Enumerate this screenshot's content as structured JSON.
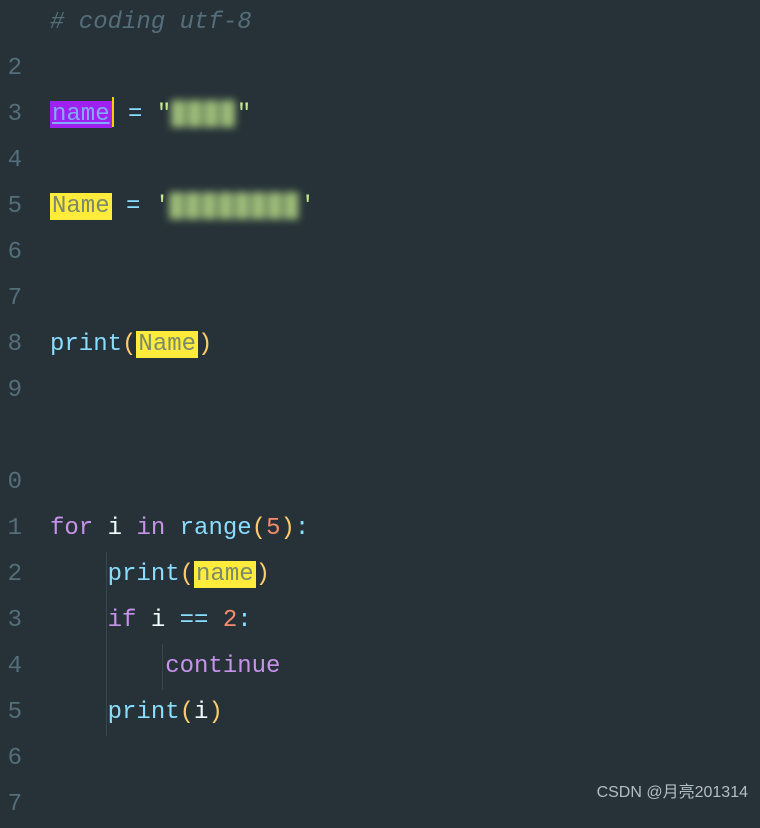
{
  "gutter": {
    "lines": [
      "",
      "2",
      "3",
      "4",
      "5",
      "6",
      "7",
      "8",
      "9",
      "",
      "0",
      "1",
      "2",
      "3",
      "4",
      "5",
      "6",
      "7"
    ]
  },
  "code": {
    "line1": {
      "comment": "# coding utf-8"
    },
    "line3": {
      "var_name": "name",
      "assign": " = ",
      "quote_open": "\"",
      "value_obscured": "▓▓▓▓",
      "quote_close": "\""
    },
    "line5": {
      "var_name": "Name",
      "assign": " = ",
      "quote_open": "'",
      "value_obscured": "▓▓▓▓▓▓▓▓",
      "quote_close": "'"
    },
    "line8": {
      "func": "print",
      "paren_open": "(",
      "arg": "Name",
      "paren_close": ")"
    },
    "line12": {
      "for_kw": "for",
      "var": " i ",
      "in_kw": "in",
      "space": " ",
      "func": "range",
      "paren_open": "(",
      "num": "5",
      "paren_close": ")",
      "colon": ":"
    },
    "line13": {
      "func": "print",
      "paren_open": "(",
      "arg": "name",
      "paren_close": ")"
    },
    "line14": {
      "if_kw": "if",
      "var": " i ",
      "op": "==",
      "space": " ",
      "num": "2",
      "colon": ":"
    },
    "line15": {
      "kw": "continue"
    },
    "line16": {
      "func": "print",
      "paren_open": "(",
      "arg": "i",
      "paren_close": ")"
    }
  },
  "watermark": "CSDN @月亮201314"
}
